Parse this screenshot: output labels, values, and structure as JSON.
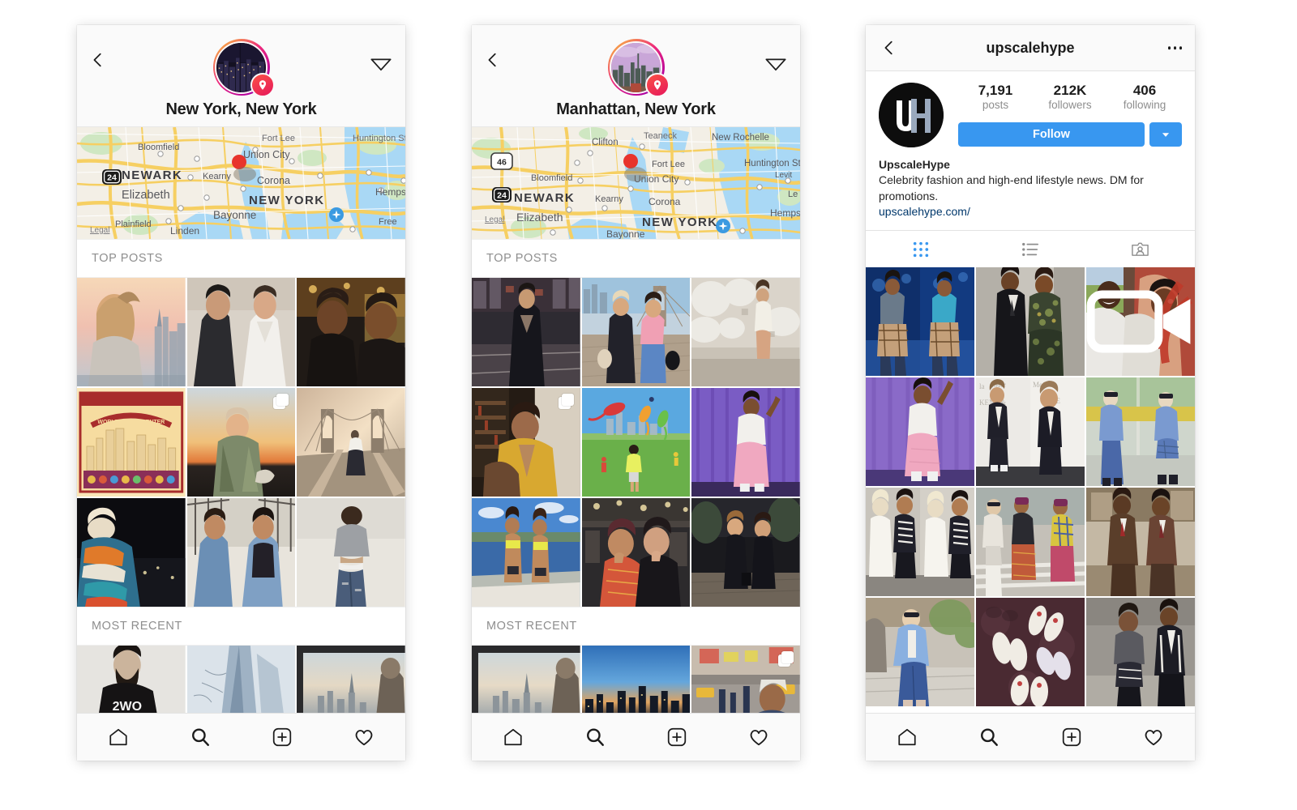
{
  "phones": [
    {
      "id": "place-new-york",
      "type": "place",
      "header": {
        "back_icon": "chevron-left-icon",
        "dm_icon": "direct-message-paper-plane-icon",
        "avatar_icon": "place-avatar-night-skyline",
        "pin_icon": "location-pin-icon",
        "title": "New York, New York"
      },
      "map": {
        "pin_color": "#e8342c",
        "labels": [
          "Bloomfield",
          "Fort Lee",
          "Huntington St",
          "Union City",
          "NEWARK",
          "Kearny",
          "Corona",
          "Elizabeth",
          "NEW YORK",
          "Hempstead",
          "Bayonne",
          "Plainfield",
          "Linden",
          "Legal",
          "Freeport"
        ],
        "shields": [
          "24"
        ]
      },
      "sections": [
        {
          "label": "TOP POSTS"
        },
        {
          "label": "MOST RECENT"
        }
      ],
      "top_posts": [
        {
          "name": "woman-rooftop-skyline",
          "multi": false,
          "video": false
        },
        {
          "name": "two-women-black-white-outfits",
          "multi": false,
          "video": false
        },
        {
          "name": "couple-selfie-restaurant",
          "multi": false,
          "video": false
        },
        {
          "name": "world-trade-center-poster",
          "multi": false,
          "video": false
        },
        {
          "name": "man-camo-jacket-sunset",
          "multi": true,
          "video": false
        },
        {
          "name": "brooklyn-bridge-walker",
          "multi": false,
          "video": false
        },
        {
          "name": "night-colorful-coat",
          "multi": false,
          "video": false
        },
        {
          "name": "two-women-denim-stairs",
          "multi": false,
          "video": false
        },
        {
          "name": "man-grey-sweater-jeans",
          "multi": false,
          "video": false
        }
      ],
      "most_recent": [
        {
          "name": "bearded-man-2wodns-shirt",
          "multi": false,
          "video": false
        },
        {
          "name": "one-world-trade-tower",
          "multi": false,
          "video": false
        },
        {
          "name": "window-skyline-view",
          "multi": false,
          "video": false
        }
      ],
      "bottom_nav": [
        "home-icon",
        "search-icon",
        "add-post-icon",
        "heart-icon"
      ]
    },
    {
      "id": "place-manhattan",
      "type": "place",
      "header": {
        "back_icon": "chevron-left-icon",
        "dm_icon": "direct-message-paper-plane-icon",
        "avatar_icon": "place-avatar-day-skyline",
        "pin_icon": "location-pin-icon",
        "title": "Manhattan, New York"
      },
      "map": {
        "pin_color": "#e8342c",
        "labels": [
          "Clifton",
          "Teaneck",
          "New Rochelle",
          "Fort Lee",
          "Huntington Stati",
          "Bloomfield",
          "Union City",
          "NEWARK",
          "Kearny",
          "Corona",
          "Le",
          "Levit",
          "Legal",
          "Elizabeth",
          "NEW YORK",
          "Hempstead",
          "Bayonne"
        ],
        "shields": [
          "46",
          "24"
        ]
      },
      "sections": [
        {
          "label": "TOP POSTS"
        },
        {
          "label": "MOST RECENT"
        }
      ],
      "top_posts": [
        {
          "name": "woman-black-jumpsuit-street",
          "multi": false,
          "video": false
        },
        {
          "name": "two-women-brooklyn-bridge",
          "multi": false,
          "video": false
        },
        {
          "name": "model-white-dress-balloons",
          "multi": false,
          "video": false
        },
        {
          "name": "woman-yellow-blazer-library",
          "multi": true,
          "video": false
        },
        {
          "name": "kites-in-park",
          "multi": false,
          "video": false
        },
        {
          "name": "man-pink-pants-runway",
          "multi": false,
          "video": false
        },
        {
          "name": "two-women-bikini-boat",
          "multi": false,
          "video": false
        },
        {
          "name": "two-women-posing-party",
          "multi": false,
          "video": false
        },
        {
          "name": "two-women-black-dresses",
          "multi": false,
          "video": false
        }
      ],
      "most_recent": [
        {
          "name": "window-skyline-view",
          "multi": false,
          "video": false
        },
        {
          "name": "manhattan-skyline-dusk",
          "multi": false,
          "video": false
        },
        {
          "name": "times-square-crowd",
          "multi": true,
          "video": false
        }
      ],
      "bottom_nav": [
        "home-icon",
        "search-icon",
        "add-post-icon",
        "heart-icon"
      ]
    },
    {
      "id": "profile-upscalehype",
      "type": "profile",
      "header": {
        "back_icon": "chevron-left-icon",
        "username": "upscalehype",
        "menu_icon": "more-options-icon"
      },
      "avatar": {
        "icon": "upscalehype-logo-avatar",
        "letters": "UH"
      },
      "stats": [
        {
          "num": "7,191",
          "label": "posts"
        },
        {
          "num": "212K",
          "label": "followers"
        },
        {
          "num": "406",
          "label": "following"
        }
      ],
      "actions": {
        "follow_label": "Follow",
        "follow_color": "#3897f0",
        "caret_icon": "chevron-down-icon"
      },
      "bio": {
        "name": "UpscaleHype",
        "description": "Celebrity fashion and high-end lifestyle news. DM for promotions.",
        "link": "upscalehype.com/",
        "link_color": "#00376b"
      },
      "tabs": [
        {
          "icon": "grid-icon",
          "active": true,
          "color": "#3897f0"
        },
        {
          "icon": "list-icon",
          "active": false,
          "color": "#8e8e8e"
        },
        {
          "icon": "tagged-person-icon",
          "active": false,
          "color": "#8e8e8e"
        }
      ],
      "posts": [
        {
          "name": "performer-blue-stage",
          "multi": false,
          "video": false
        },
        {
          "name": "men-suits-camo-outfit",
          "multi": false,
          "video": false
        },
        {
          "name": "men-laughing-red-car",
          "multi": false,
          "video": true
        },
        {
          "name": "man-pink-pants-purple-curtain",
          "multi": false,
          "video": false
        },
        {
          "name": "man-black-jacket-kent-backdrop",
          "multi": false,
          "video": false
        },
        {
          "name": "woman-denim-jacket-plaid-skirt",
          "multi": false,
          "video": false
        },
        {
          "name": "couple-white-striped-outfits",
          "multi": false,
          "video": false
        },
        {
          "name": "group-crosswalk-patterned-pants",
          "multi": false,
          "video": false
        },
        {
          "name": "two-men-brown-suits",
          "multi": false,
          "video": false
        },
        {
          "name": "woman-blue-coat-jeans-street",
          "multi": false,
          "video": false
        },
        {
          "name": "sneakers-from-above",
          "multi": false,
          "video": false
        },
        {
          "name": "family-black-outfits",
          "multi": false,
          "video": false
        }
      ],
      "bottom_nav": [
        "home-icon",
        "search-icon",
        "add-post-icon",
        "heart-icon"
      ]
    }
  ]
}
